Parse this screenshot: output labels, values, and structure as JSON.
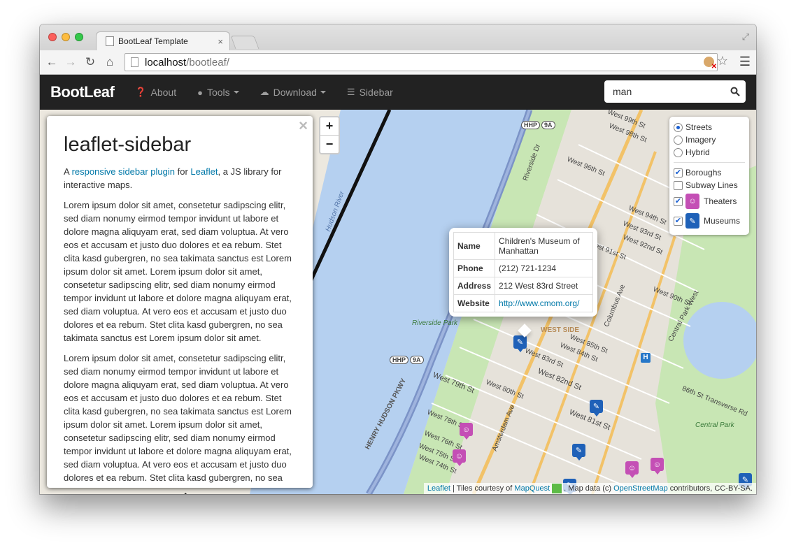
{
  "browser": {
    "tab_title": "BootLeaf Template",
    "tab_close": "×",
    "url_host": "localhost",
    "url_path": "/bootleaf/",
    "back_icon": "back-arrow-icon",
    "forward_icon": "forward-arrow-icon",
    "reload_icon": "reload-icon",
    "home_icon": "home-icon"
  },
  "navbar": {
    "brand": "BootLeaf",
    "about": "About",
    "tools": "Tools",
    "download": "Download",
    "sidebar": "Sidebar",
    "search_value": "man"
  },
  "sidebar": {
    "close": "×",
    "title": "leaflet-sidebar",
    "intro_prefix": "A ",
    "intro_link1": "responsive sidebar plugin",
    "intro_mid": " for ",
    "intro_link2": "Leaflet",
    "intro_suffix": ", a JS library for interactive maps.",
    "para1": "Lorem ipsum dolor sit amet, consetetur sadipscing elitr, sed diam nonumy eirmod tempor invidunt ut labore et dolore magna aliquyam erat, sed diam voluptua. At vero eos et accusam et justo duo dolores et ea rebum. Stet clita kasd gubergren, no sea takimata sanctus est Lorem ipsum dolor sit amet. Lorem ipsum dolor sit amet, consetetur sadipscing elitr, sed diam nonumy eirmod tempor invidunt ut labore et dolore magna aliquyam erat, sed diam voluptua. At vero eos et accusam et justo duo dolores et ea rebum. Stet clita kasd gubergren, no sea takimata sanctus est Lorem ipsum dolor sit amet.",
    "para2": "Lorem ipsum dolor sit amet, consetetur sadipscing elitr, sed diam nonumy eirmod tempor invidunt ut labore et dolore magna aliquyam erat, sed diam voluptua. At vero eos et accusam et justo duo dolores et ea rebum. Stet clita kasd gubergren, no sea takimata sanctus est Lorem ipsum dolor sit amet. Lorem ipsum dolor sit amet, consetetur sadipscing elitr, sed diam nonumy eirmod tempor invidunt ut labore et dolore magna aliquyam erat, sed diam voluptua. At vero eos et accusam et justo duo dolores et ea rebum. Stet clita kasd gubergren, no sea"
  },
  "zoom": {
    "in": "+",
    "out": "−"
  },
  "layers": {
    "base": [
      {
        "label": "Streets",
        "checked": true
      },
      {
        "label": "Imagery",
        "checked": false
      },
      {
        "label": "Hybrid",
        "checked": false
      }
    ],
    "overlays": [
      {
        "label": "Boroughs",
        "checked": true
      },
      {
        "label": "Subway Lines",
        "checked": false
      },
      {
        "label": "Theaters",
        "checked": true,
        "icon": "theater-icon",
        "color": "#c44fb5"
      },
      {
        "label": "Museums",
        "checked": true,
        "icon": "museum-icon",
        "color": "#1f61b8"
      }
    ]
  },
  "popup": {
    "rows": [
      {
        "key": "Name",
        "value": "Children's Museum of Manhattan"
      },
      {
        "key": "Phone",
        "value": "(212) 721-1234"
      },
      {
        "key": "Address",
        "value": "212 West 83rd Street"
      },
      {
        "key": "Website",
        "value": "http://www.cmom.org/"
      }
    ]
  },
  "attribution": {
    "leaflet": "Leaflet",
    "tiles": " | Tiles courtesy of ",
    "mapquest": "MapQuest",
    "data": ". Map data (c) ",
    "osm": "OpenStreetMap",
    "license": " contributors, CC-BY-SA."
  },
  "map_labels": {
    "river": "Hudson River",
    "riverside_dr": "Riverside Dr",
    "riverside_park": "Riverside Park",
    "henry_hudson": "HENRY HUDSON PKWY",
    "west_side": "WEST SIDE",
    "amsterdam": "Amsterdam Ave",
    "columbus": "Columbus Ave",
    "cpw": "Central Park West",
    "w79": "West 79th St",
    "w82": "West 82nd St",
    "w81": "West 81st St",
    "w83": "West 83rd St",
    "w84": "West 84th St",
    "w85": "West 85th St",
    "w86": "86th St Transverse Rd",
    "w90": "West 90th St",
    "w91": "West 91st St",
    "w92": "West 92nd St",
    "w93": "West 93rd St",
    "w94": "West 94th St",
    "w98": "West 98th St",
    "w99": "West 99th St",
    "w96": "West 96th St",
    "w80": "West 80th St",
    "w78": "West 78th St",
    "w76": "West 76th St",
    "w75": "West 75th St",
    "w74": "West 74th St",
    "central_park": "Central Park",
    "hhp": "HHP",
    "nine_a": "9A"
  },
  "colors": {
    "navbar_bg": "#222222",
    "water": "#b5d0f0",
    "park": "#c8e6b4",
    "theater": "#c44fb5",
    "museum": "#1f61b8"
  }
}
